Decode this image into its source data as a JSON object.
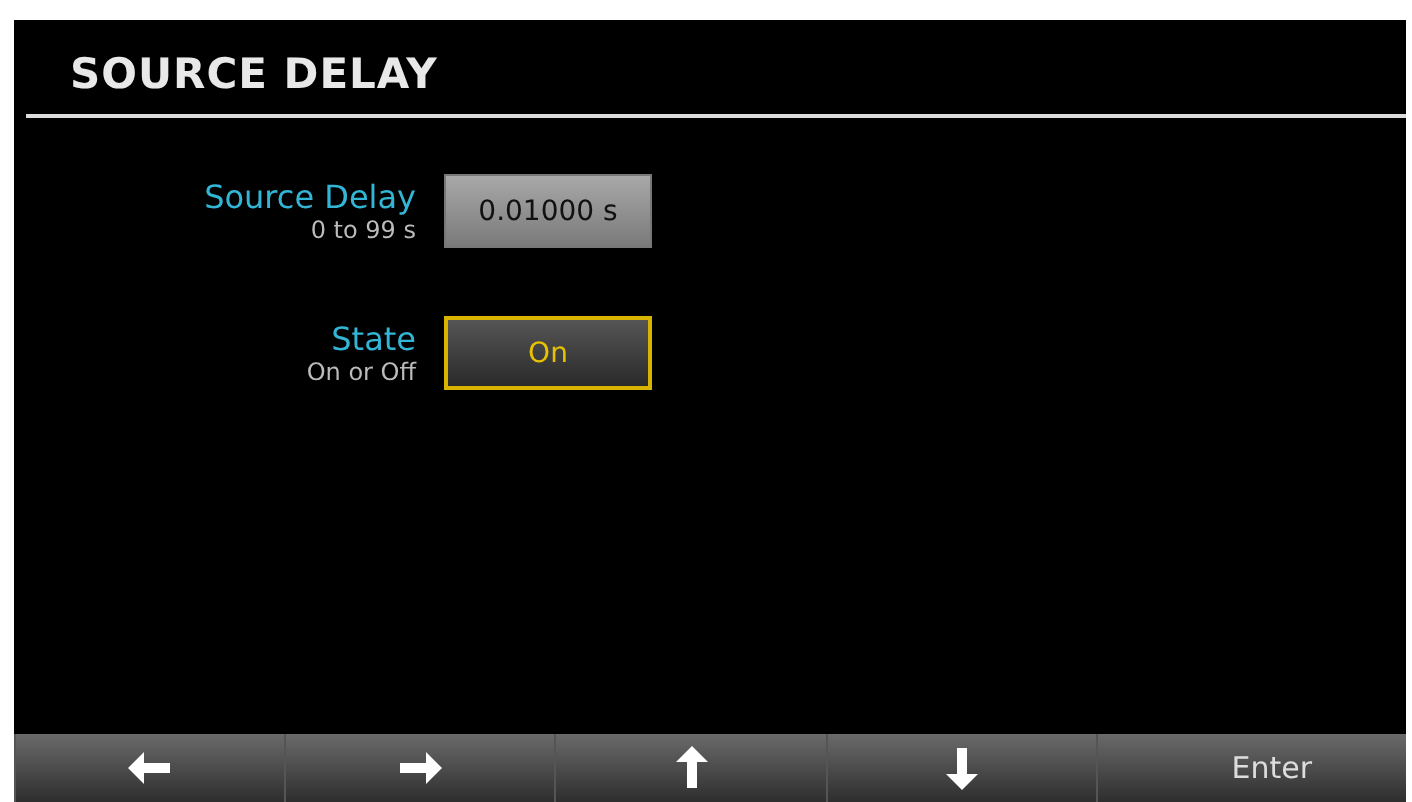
{
  "title": "SOURCE DELAY",
  "settings": [
    {
      "label": "Source Delay",
      "range": "0 to 99 s",
      "value": "0.01000 s",
      "focused": false
    },
    {
      "label": "State",
      "range": "On or Off",
      "value": "On",
      "focused": true
    }
  ],
  "softkeys": [
    {
      "kind": "left"
    },
    {
      "kind": "right"
    },
    {
      "kind": "up"
    },
    {
      "kind": "down"
    },
    {
      "kind": "text",
      "label": "Enter"
    }
  ]
}
